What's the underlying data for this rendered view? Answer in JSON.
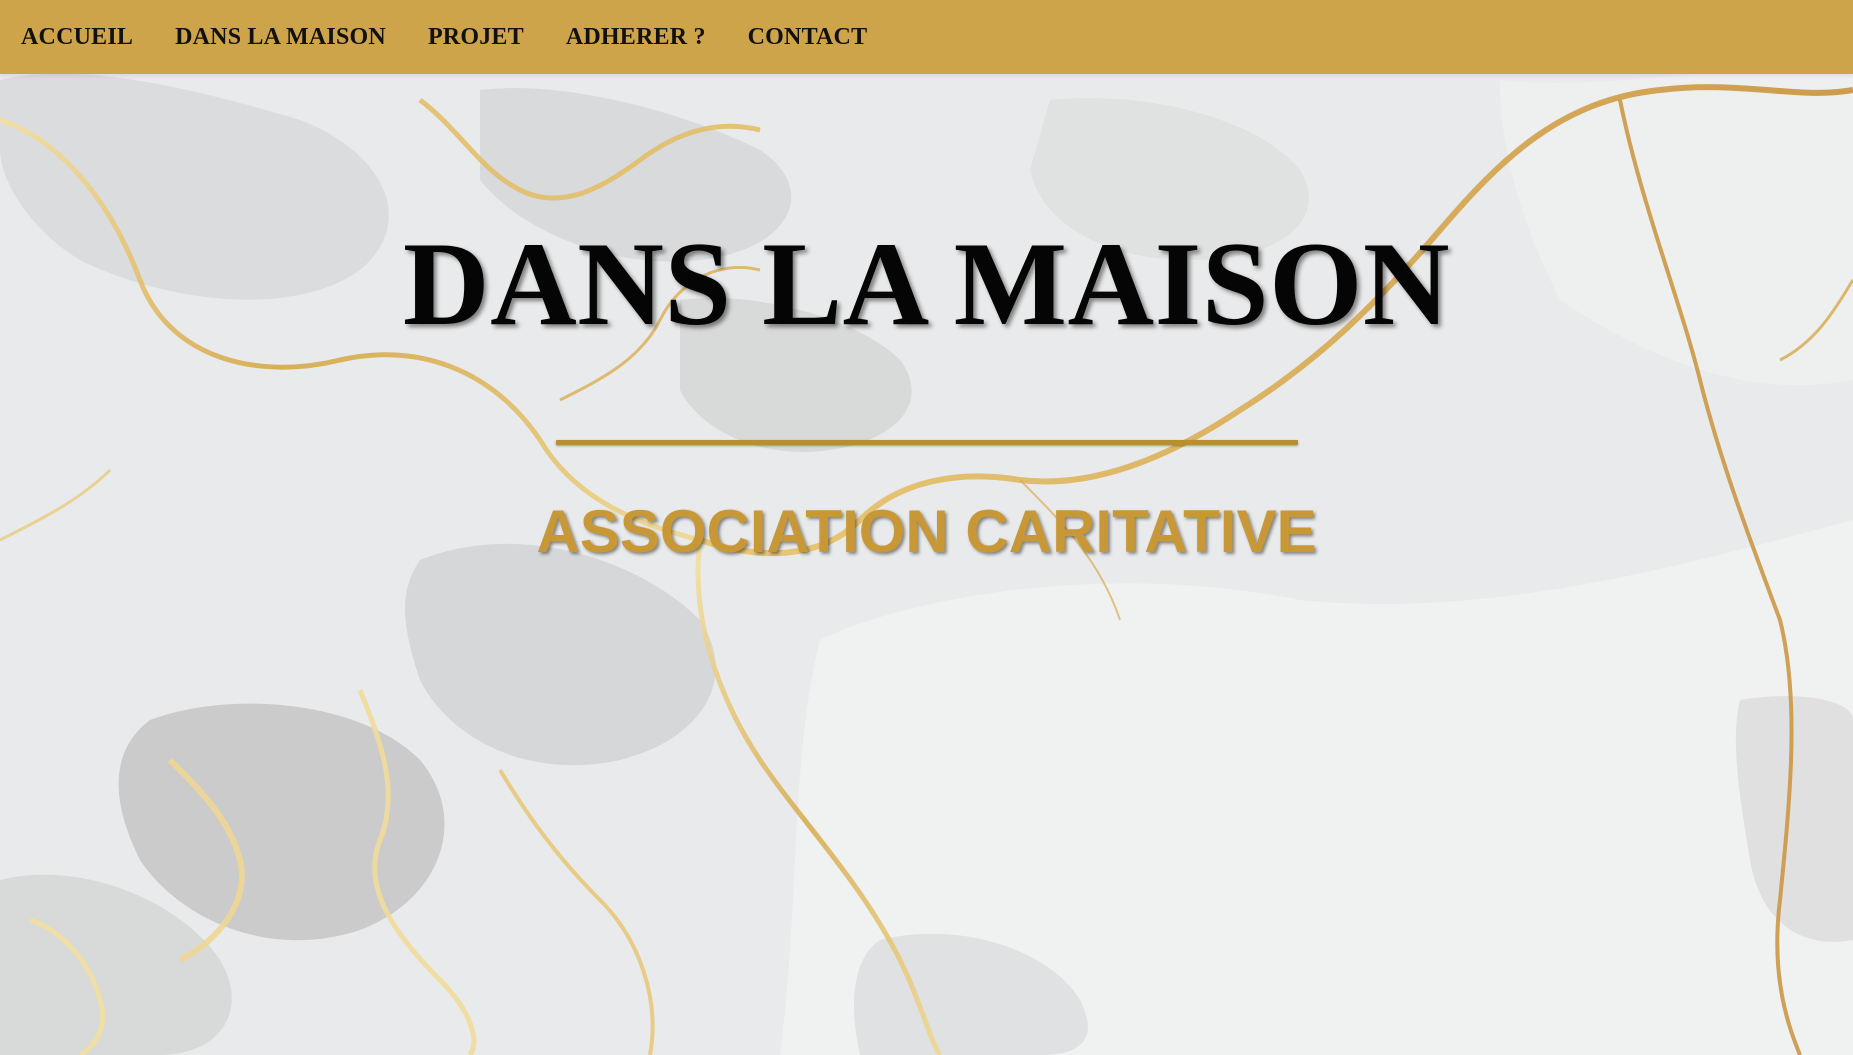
{
  "nav": {
    "items": [
      {
        "label": "ACCUEIL"
      },
      {
        "label": "DANS LA MAISON"
      },
      {
        "label": "PROJET"
      },
      {
        "label": "ADHERER ?"
      },
      {
        "label": "CONTACT"
      }
    ]
  },
  "hero": {
    "title": "DANS LA MAISON",
    "subtitle": "ASSOCIATION CARITATIVE"
  },
  "colors": {
    "nav_background": "#cda44a",
    "accent_gold": "#c99836",
    "marble_base": "#e9eaeb"
  }
}
